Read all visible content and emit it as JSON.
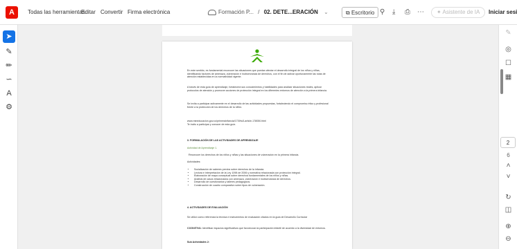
{
  "toolbar": {
    "logo": "A",
    "menu": [
      "Todas las herramientas",
      "Editar",
      "Convertir",
      "Firma electrónica"
    ],
    "breadcrumb_folder": "Formación P...",
    "breadcrumb_sep": "/",
    "breadcrumb_file": "02. DETE...ERACIÓN",
    "desktop_label": "Escritorio",
    "assistant_label": "Asistente de IA",
    "signin_label": "Iniciar sesión"
  },
  "page_indicator": {
    "current": "2",
    "total": "6"
  },
  "document": {
    "p1": "En este sentido, es fundamental reconocer las situaciones que puedan afectar el desarrollo integral de los niños y niñas, identificando factores de amenaza, vulneración e inobservancia de derechos, con el fin de activar oportunamente las rutas de atención establecidas en la normatividad vigente.",
    "p2": "A través de esta guía de aprendizaje, fortalecerá sus conocimientos y habilidades para analizar situaciones reales, aplicar protocolos de atención y promover acciones de protección integral en los diferentes entornos de atención a la primera infancia.",
    "p3": "Se invita a participar activamente en el desarrollo de las actividades propuestas, fortaleciendo el compromiso ético y profesional frente a la protección de los derechos de la niñez.",
    "link": "www.mineducacion.gov.co/primerainfancia/1739/w3-article-178050.html",
    "link_note": "Te invito a participar y conocer de esta guía",
    "h3": "3.  FORMULACIÓN DE LAS ACTIVIDADES DE APRENDIZAJE",
    "activity_title": "Actividad de Aprendizaje 1.",
    "activity_desc": "Reconocer los derechos de los niños y niñas y las situaciones de vulneración en la primera infancia.",
    "activities_label": "Actividades:",
    "bullets": [
      "Socialización de saberes previos sobre derechos de la infancia.",
      "Lectura e interpretación de la Ley 1098 de 2006 y normativa relacionada con protección integral.",
      "Elaboración de mapa conceptual sobre derechos fundamentales de los niños y niñas.",
      "Análisis de casos relacionados con amenaza, vulneración e inobservancia de derechos.",
      "Desarrollo de cuestionarios y talleres pedagógicos.",
      "Construcción de cuadro comparativo sobre tipos de vulneración."
    ],
    "h4": "4. ACTIVIDADES DE EVALUACIÓN",
    "eval_text": "Se utilizó como referencia la técnica e instrumentos de evaluación citados en la guía de Desarrollo Curricular",
    "cognitiva_label": "COGNITIVA:",
    "cognitiva_text": "Identificar espacios significativos que favorezcan la participación infantil de acuerdo a la diversidad de entornos.",
    "sub_label": "Sub Actividades 2:"
  },
  "colors": {
    "accent": "#1473e6",
    "brand": "#eb1000",
    "sena_green": "#39a900"
  }
}
